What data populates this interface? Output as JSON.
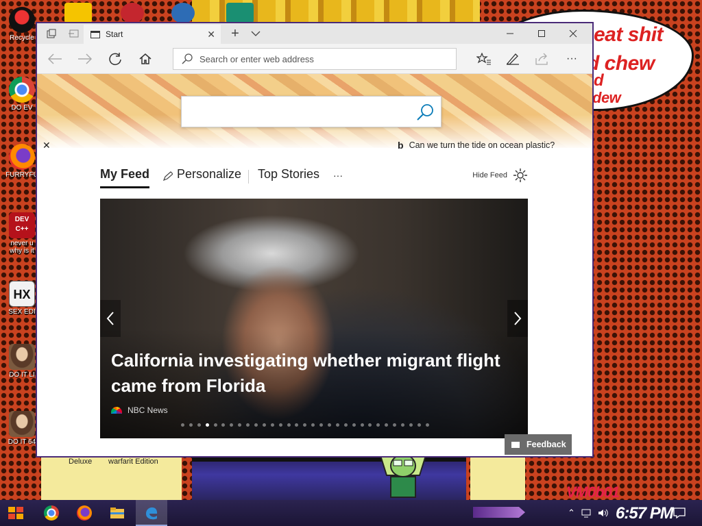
{
  "desktop": {
    "bubble_lines": [
      "eat shit",
      "d chew",
      "d",
      "dew"
    ],
    "icons": [
      {
        "label": "Recycle",
        "icon": "recycle-bin-icon"
      },
      {
        "label": "DO EV",
        "icon": "chrome-icon"
      },
      {
        "label": "FURRYFU",
        "icon": "firefox-icon"
      },
      {
        "label": "never u",
        "label2": "why is it",
        "icon": "devcpp-icon",
        "badge": "DEV C++"
      },
      {
        "label": "SEX EDI",
        "icon": "hex-editor-icon",
        "badge": "HX"
      },
      {
        "label": "DO IT LI",
        "icon": "portrait-icon"
      },
      {
        "label": "DO IT 64",
        "icon": "portrait-icon"
      }
    ],
    "bottom_labels": [
      "Deluxe",
      "warfarit Edition"
    ],
    "watermark": "VM0b01"
  },
  "browser": {
    "tab_title": "Start",
    "address_placeholder": "Search or enter web address",
    "bing_caption": "Can we turn the tide on ocean plastic?",
    "hero_search_value": "",
    "feed_tabs": {
      "my_feed": "My Feed",
      "personalize": "Personalize",
      "top_stories": "Top Stories",
      "more": "···"
    },
    "hide_feed": "Hide Feed",
    "carousel": {
      "headline": "California investigating whether migrant flight came from Florida",
      "source": "NBC News",
      "dot_count": 31,
      "active_dot": 3
    },
    "feedback_label": "Feedback"
  },
  "taskbar": {
    "apps": [
      "start-icon",
      "chrome-icon",
      "firefox-icon",
      "file-explorer-icon",
      "edge-icon"
    ],
    "active_app": "edge-icon",
    "clock": "6:57 PM"
  },
  "colors": {
    "window_border": "#4a2b78",
    "taskbar": "#2b2350",
    "accent": "#0078d7"
  }
}
